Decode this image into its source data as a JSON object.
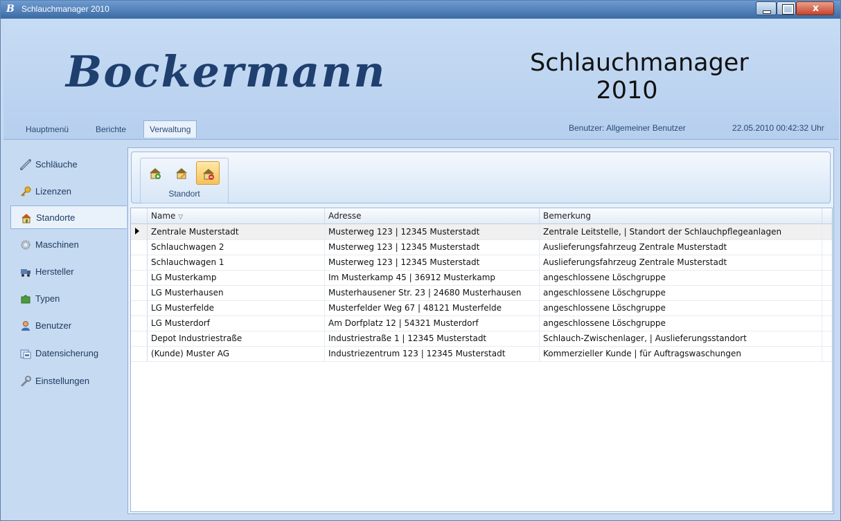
{
  "window": {
    "title": "Schlauchmanager 2010",
    "close_label": "x"
  },
  "header": {
    "brand": "Bockermann",
    "app_title_line1": "Schlauchmanager",
    "app_title_line2": "2010",
    "menu": [
      "Hauptmenü",
      "Berichte",
      "Verwaltung"
    ],
    "active_menu": "Verwaltung",
    "user": "Benutzer: Allgemeiner Benutzer",
    "datetime": "22.05.2010 00:42:32 Uhr"
  },
  "sidebar": {
    "items": [
      {
        "label": "Schläuche",
        "icon": "hose-icon"
      },
      {
        "label": "Lizenzen",
        "icon": "key-icon"
      },
      {
        "label": "Standorte",
        "icon": "house-icon"
      },
      {
        "label": "Maschinen",
        "icon": "gear-icon"
      },
      {
        "label": "Hersteller",
        "icon": "truck-icon"
      },
      {
        "label": "Typen",
        "icon": "puzzle-icon"
      },
      {
        "label": "Benutzer",
        "icon": "user-icon"
      },
      {
        "label": "Datensicherung",
        "icon": "backup-icon"
      },
      {
        "label": "Einstellungen",
        "icon": "wrench-icon"
      }
    ],
    "active": "Standorte"
  },
  "ribbon": {
    "group_label": "Standort",
    "buttons": [
      "add-location-icon",
      "edit-location-icon",
      "delete-location-icon"
    ]
  },
  "grid": {
    "columns": [
      "Name",
      "Adresse",
      "Bemerkung"
    ],
    "sort_indicator": "▽",
    "rows": [
      {
        "name": "Zentrale Musterstadt",
        "adresse": "Musterweg 123 | 12345 Musterstadt",
        "bemerkung": "Zentrale Leitstelle, | Standort der Schlauchpflegeanlagen"
      },
      {
        "name": "Schlauchwagen 2",
        "adresse": "Musterweg 123 | 12345 Musterstadt",
        "bemerkung": "Auslieferungsfahrzeug Zentrale Musterstadt"
      },
      {
        "name": "Schlauchwagen 1",
        "adresse": "Musterweg 123 | 12345 Musterstadt",
        "bemerkung": "Auslieferungsfahrzeug Zentrale Musterstadt"
      },
      {
        "name": "LG Musterkamp",
        "adresse": "Im Musterkamp 45 | 36912 Musterkamp",
        "bemerkung": "angeschlossene Löschgruppe"
      },
      {
        "name": "LG Musterhausen",
        "adresse": "Musterhausener Str. 23 | 24680 Musterhausen",
        "bemerkung": "angeschlossene Löschgruppe"
      },
      {
        "name": "LG Musterfelde",
        "adresse": "Musterfelder Weg 67 | 48121 Musterfelde",
        "bemerkung": "angeschlossene Löschgruppe"
      },
      {
        "name": "LG Musterdorf",
        "adresse": "Am Dorfplatz 12 | 54321 Musterdorf",
        "bemerkung": "angeschlossene Löschgruppe"
      },
      {
        "name": "Depot Industriestraße",
        "adresse": "Industriestraße 1 | 12345 Musterstadt",
        "bemerkung": "Schlauch-Zwischenlager, | Auslieferungsstandort"
      },
      {
        "name": "(Kunde) Muster AG",
        "adresse": "Industriezentrum 123 | 12345 Musterstadt",
        "bemerkung": "Kommerzieller Kunde | für Auftragswaschungen"
      }
    ]
  }
}
